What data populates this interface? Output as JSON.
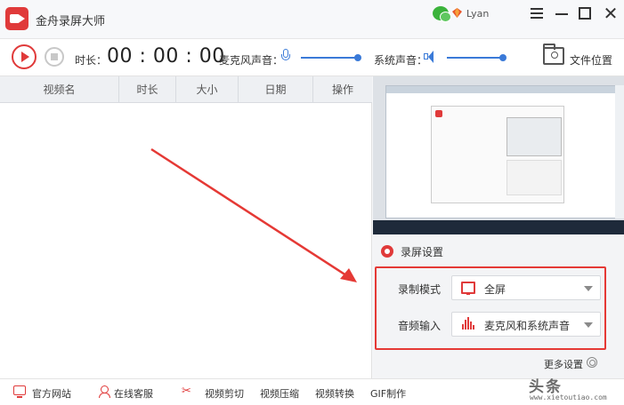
{
  "app": {
    "title": "金舟录屏大师",
    "username": "Lyan",
    "brand_color": "#e03a3a"
  },
  "toolbar": {
    "duration_label": "时长：",
    "timer": "00 : 00 : 00",
    "mic_label": "麦克风声音：",
    "system_label": "系统声音：",
    "file_location_label": "文件位置",
    "mic_volume": 1.0,
    "system_volume": 1.0
  },
  "table": {
    "columns": [
      "视频名",
      "时长",
      "大小",
      "日期",
      "操作"
    ],
    "rows": []
  },
  "settings": {
    "title": "录屏设置",
    "record_mode_label": "录制模式",
    "record_mode_value": "全屏",
    "audio_input_label": "音频输入",
    "audio_input_value": "麦克风和系统声音",
    "more_settings": "更多设置"
  },
  "bottom": {
    "website": "官方网站",
    "support": "在线客服",
    "video_cut": "视频剪切",
    "video_compress": "视频压缩",
    "video_convert": "视频转换",
    "gif_make": "GIF制作"
  },
  "watermark": {
    "text": "头条",
    "url": "www.xietoutiao.com"
  },
  "icons": [
    "app-logo-icon",
    "wechat-icon",
    "vip-icon",
    "menu-icon",
    "minimize-icon",
    "maximize-icon",
    "close-icon",
    "play-icon",
    "stop-icon",
    "mic-icon",
    "speaker-icon",
    "folder-icon",
    "gear-icon",
    "monitor-icon",
    "waveform-icon",
    "chevron-down-icon",
    "website-icon",
    "support-icon",
    "scissors-icon"
  ]
}
